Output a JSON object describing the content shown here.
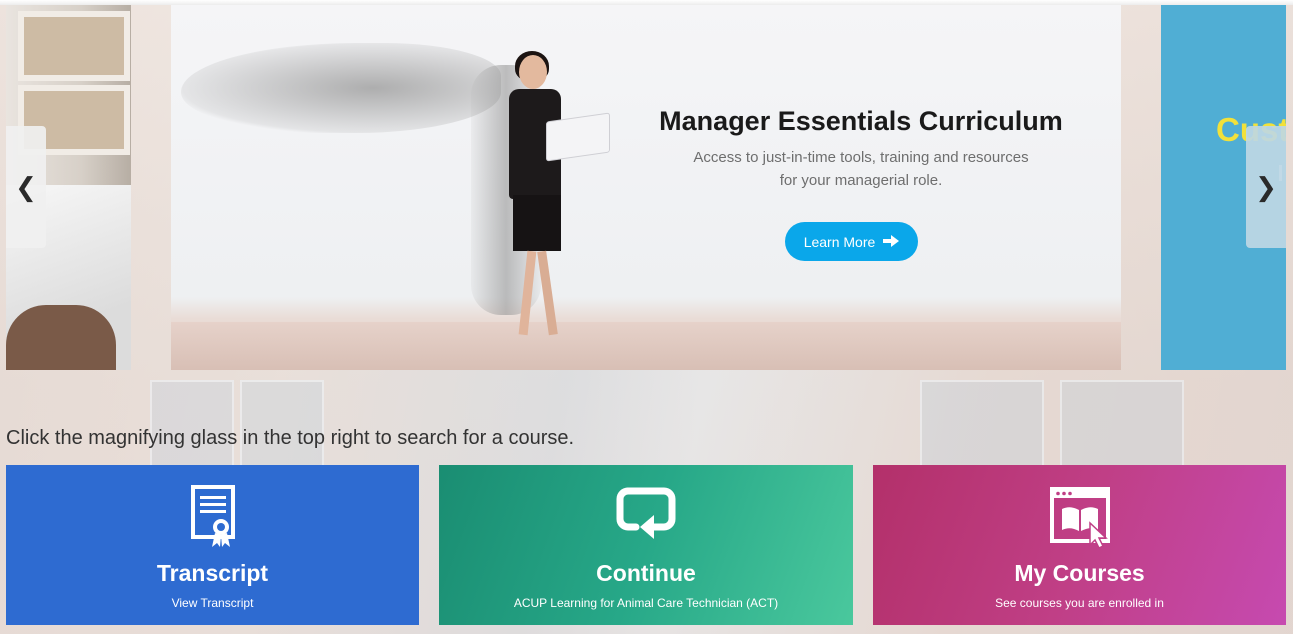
{
  "carousel": {
    "active_slide": {
      "title": "Manager Essentials Curriculum",
      "description": "Access to just-in-time tools, training and resources for your managerial role.",
      "button_label": "Learn More",
      "button_icon": "arrow-right-icon"
    },
    "next_slide": {
      "title": "Cust"
    },
    "prev_icon": "chevron-left-icon",
    "next_icon": "chevron-right-icon",
    "prev_glyph": "❮",
    "next_glyph": "❯"
  },
  "hint_text": "Click the magnifying glass in the top right to search for a course.",
  "tiles": [
    {
      "title": "Transcript",
      "subtitle": "View Transcript",
      "icon": "certificate-icon",
      "color": "#2e6bd1"
    },
    {
      "title": "Continue",
      "subtitle": "ACUP Learning for Animal Care Technician (ACT)",
      "icon": "continue-icon",
      "color": "#27a888"
    },
    {
      "title": "My Courses",
      "subtitle": "See courses you are enrolled in",
      "icon": "book-browser-icon",
      "color": "#c03f86"
    }
  ],
  "colors": {
    "accent_button": "#0aa7ea",
    "next_slide_bg": "#50aed4",
    "next_slide_title": "#f2e13a"
  }
}
